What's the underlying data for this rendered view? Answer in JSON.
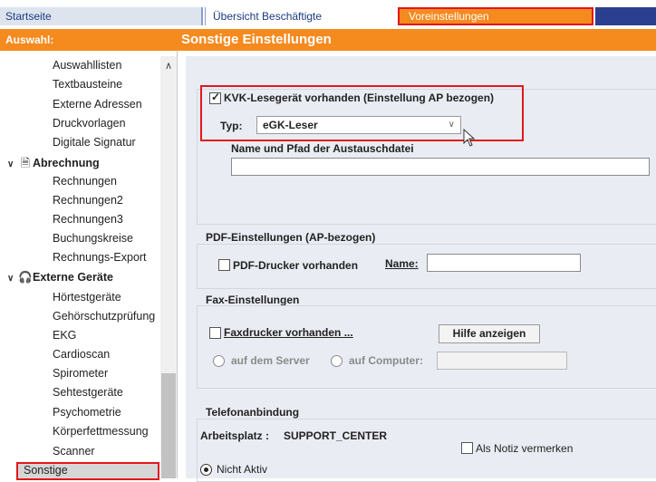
{
  "tabs": [
    {
      "label": "Startseite"
    },
    {
      "label": "Übersicht Beschäftigte"
    },
    {
      "label": "Voreinstellungen"
    }
  ],
  "header": {
    "left": "Auswahl:",
    "title": "Sonstige Einstellungen"
  },
  "sidebar": {
    "items_top": [
      "Auswahllisten",
      "Textbausteine",
      "Externe Adressen",
      "Druckvorlagen",
      "Digitale Signatur"
    ],
    "group_abrechnung": {
      "label": "Abrechnung",
      "icon": "document-icon",
      "items": [
        "Rechnungen",
        "Rechnungen2",
        "Rechnungen3",
        "Buchungskreise",
        "Rechnungs-Export"
      ]
    },
    "group_geraete": {
      "label": "Externe Geräte",
      "icon": "headphones-icon",
      "items": [
        "Hörtestgeräte",
        "Gehörschutzprüfung",
        "EKG",
        "Cardioscan",
        "Spirometer",
        "Sehtestgeräte",
        "Psychometrie",
        "Körperfettmessung",
        "Scanner"
      ]
    },
    "selected": "Sonstige"
  },
  "kvk": {
    "checkbox_label": "KVK-Lesegerät vorhanden (Einstellung AP bezogen)",
    "checked": true,
    "type_label": "Typ:",
    "type_value": "eGK-Leser",
    "path_label": "Name und Pfad der Austauschdatei",
    "path_value": ""
  },
  "pdf": {
    "title": "PDF-Einstellungen (AP-bezogen)",
    "checkbox_label": "PDF-Drucker vorhanden",
    "name_label": "Name:",
    "name_value": ""
  },
  "fax": {
    "title": "Fax-Einstellungen",
    "checkbox_label": "Faxdrucker vorhanden ...",
    "help_button": "Hilfe anzeigen",
    "radio_server": "auf dem Server",
    "radio_computer": "auf Computer:",
    "computer_value": ""
  },
  "telefon": {
    "title": "Telefonanbindung",
    "workplace_label": "Arbeitsplatz :",
    "workplace_value": "SUPPORT_CENTER",
    "note_checkbox": "Als Notiz vermerken",
    "radio_inactive": "Nicht Aktiv"
  },
  "colors": {
    "accent": "#f58a1f",
    "tab_dark": "#2a3f8f",
    "highlight": "#e2161b"
  }
}
